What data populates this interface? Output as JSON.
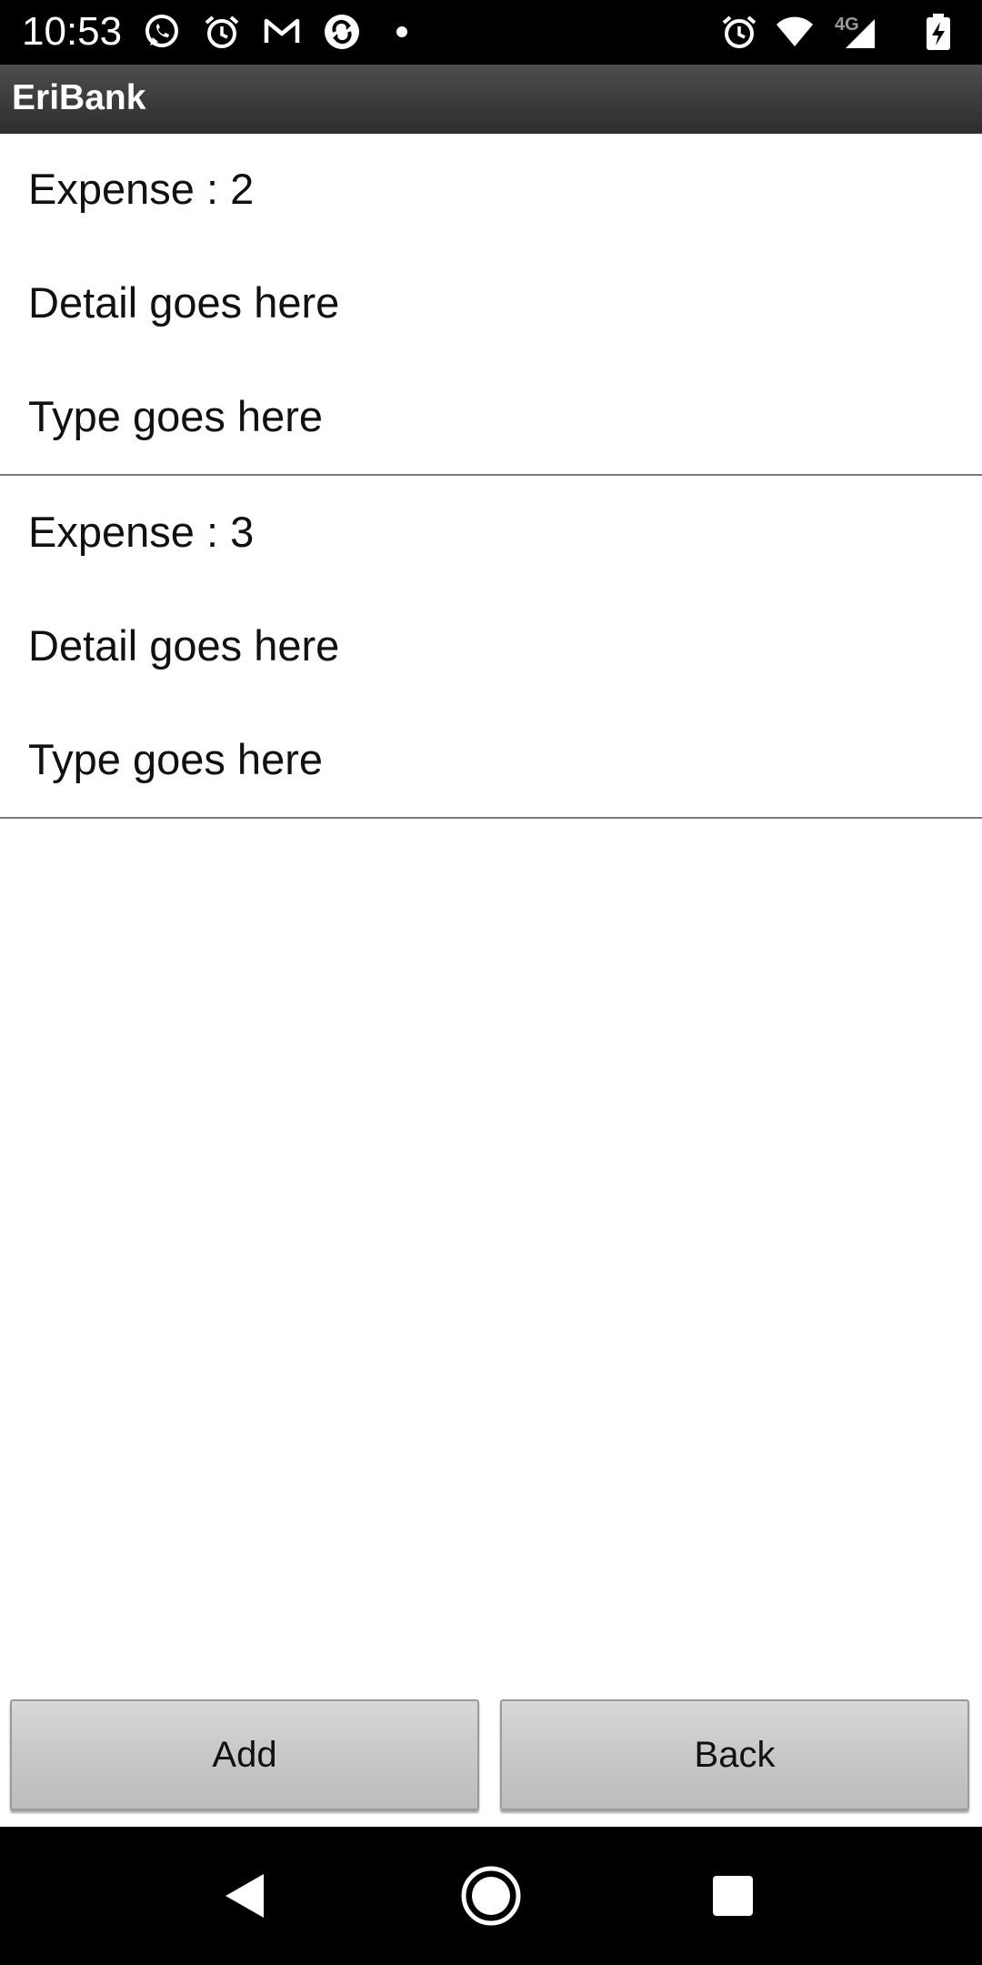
{
  "status_bar": {
    "time": "10:53",
    "left_icons": [
      "whatsapp-icon",
      "alarm-icon",
      "gmail-icon",
      "sync-app-icon",
      "notification-dot-icon"
    ],
    "right_icons": [
      "alarm-icon",
      "wifi-icon",
      "network-4g-icon",
      "battery-charging-icon"
    ],
    "network_label": "4G"
  },
  "action_bar": {
    "title": "EriBank"
  },
  "expenses": [
    {
      "title": "Expense : 2",
      "detail": "Detail goes here",
      "type": "Type goes here"
    },
    {
      "title": "Expense : 3",
      "detail": "Detail goes here",
      "type": "Type goes here"
    }
  ],
  "buttons": {
    "add_label": "Add",
    "back_label": "Back"
  },
  "navigation": {
    "icons": [
      "back-nav-icon",
      "home-nav-icon",
      "recents-nav-icon"
    ]
  }
}
